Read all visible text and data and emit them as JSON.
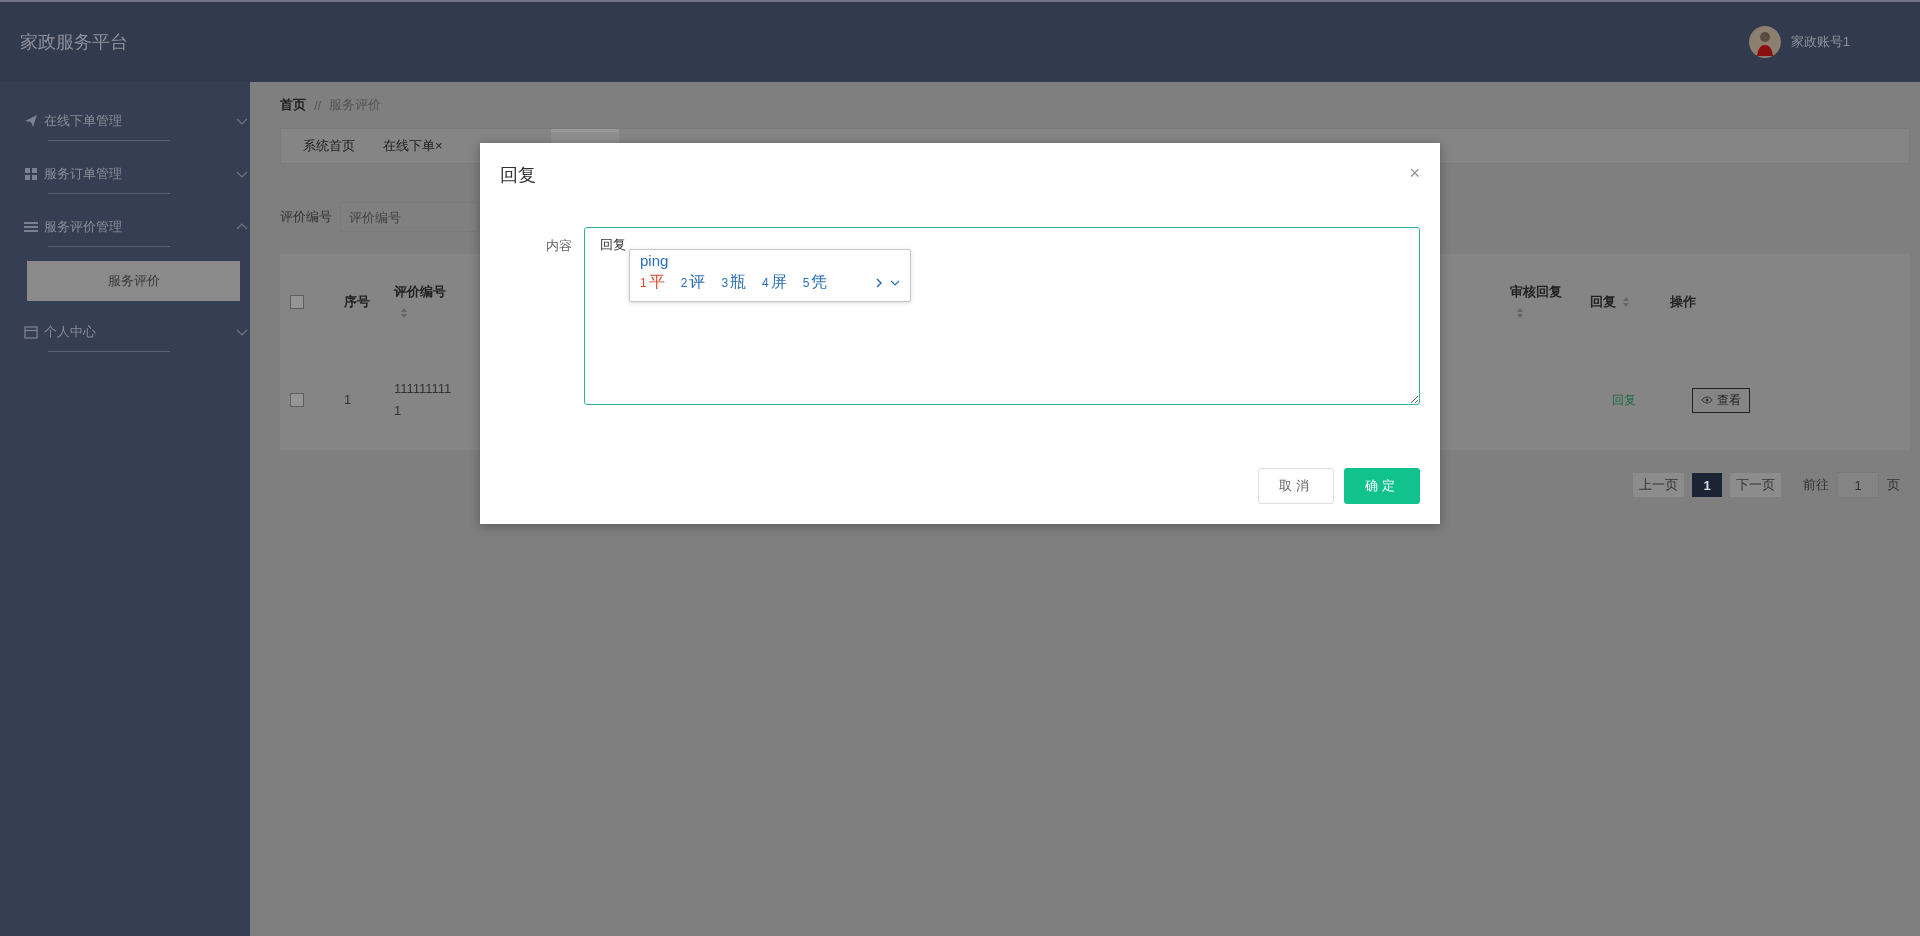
{
  "header": {
    "title": "家政服务平台",
    "user": "家政账号1"
  },
  "sidebar": {
    "items": [
      {
        "label": "在线下单管理",
        "kind": "send",
        "expanded": false
      },
      {
        "label": "服务订单管理",
        "kind": "grid",
        "expanded": false
      },
      {
        "label": "服务评价管理",
        "kind": "list",
        "expanded": true,
        "children": [
          {
            "label": "服务评价",
            "selected": true
          }
        ]
      },
      {
        "label": "个人中心",
        "kind": "card",
        "expanded": false
      }
    ]
  },
  "breadcrumb": {
    "items": [
      "首页",
      "服务评价"
    ],
    "separator": "//"
  },
  "tabs": [
    {
      "label": "系统首页",
      "selected": false
    },
    {
      "label": "在线下单",
      "close": "×",
      "selected": false
    },
    {
      "selected": true
    }
  ],
  "search": {
    "label": "评价编号",
    "placeholder": "评价编号"
  },
  "table": {
    "header_checked": false,
    "left_columns": [
      {
        "label": "序号",
        "sortable": false
      },
      {
        "label": "评价编号",
        "sortable": true
      }
    ],
    "right_columns": [
      {
        "label": "审核回复",
        "sortable": true
      },
      {
        "label": "回复",
        "sortable": true
      },
      {
        "label": "操作",
        "sortable": false
      }
    ],
    "rows": [
      {
        "checked": false,
        "index": "1",
        "code": "1111111111",
        "reply": "回复",
        "action": "查看"
      }
    ]
  },
  "pagination": {
    "prev": "上一页",
    "pages": [
      {
        "label": "1",
        "selected": true
      }
    ],
    "next": "下一页",
    "goto": "前往",
    "page": "1",
    "suffix": "页"
  },
  "dialog": {
    "title": "回复",
    "close": "×",
    "field_label": "内容",
    "value": "回复",
    "ime": {
      "input": "ping",
      "candidates": [
        {
          "index": "1",
          "text": "平",
          "selected": true
        },
        {
          "index": "2",
          "text": "评",
          "selected": false
        },
        {
          "index": "3",
          "text": "瓶",
          "selected": false
        },
        {
          "index": "4",
          "text": "屏",
          "selected": false
        },
        {
          "index": "5",
          "text": "凭",
          "selected": false
        }
      ]
    },
    "buttons": [
      {
        "kind": "cancel",
        "label": "取消"
      },
      {
        "kind": "confirm",
        "label": "确定"
      }
    ]
  }
}
